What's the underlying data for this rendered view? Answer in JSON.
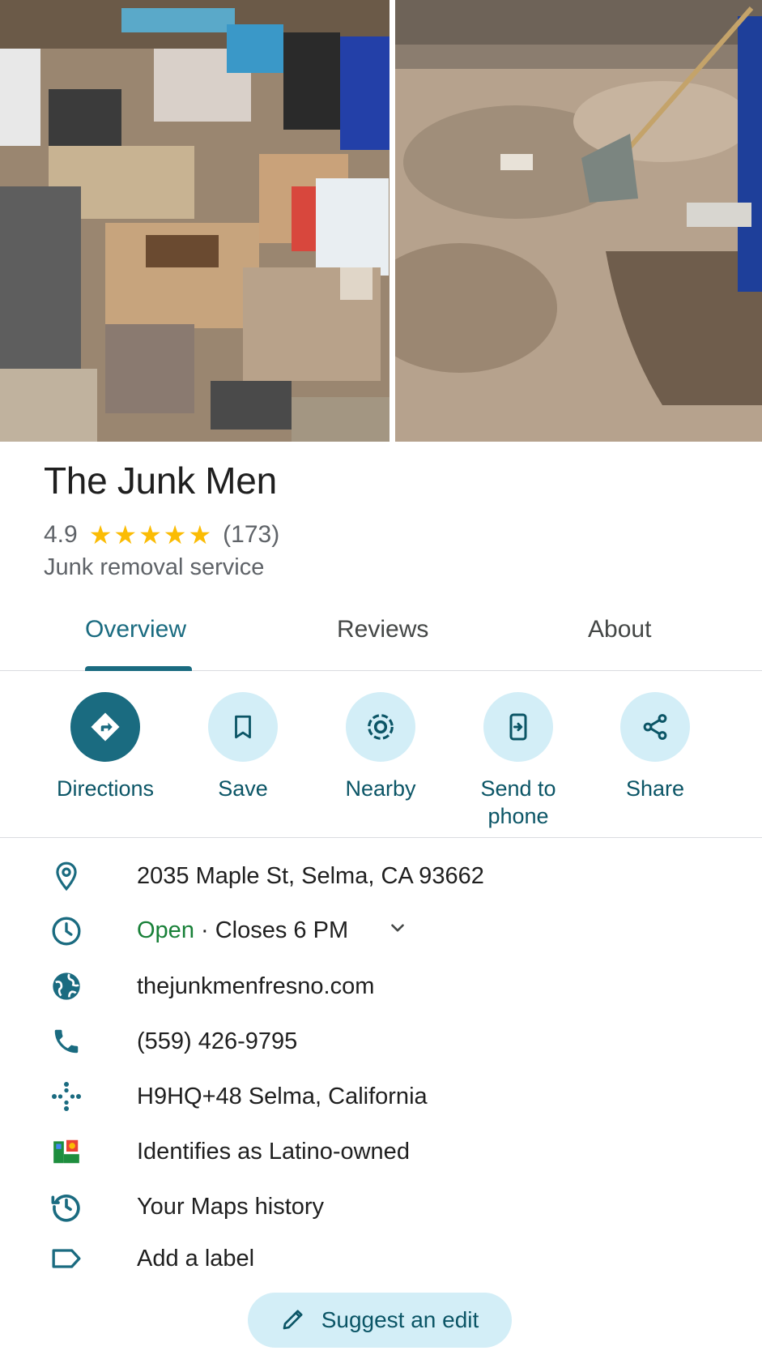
{
  "place": {
    "name": "The Junk Men",
    "rating": "4.9",
    "stars": 5,
    "review_count": "(173)",
    "category": "Junk removal service"
  },
  "tabs": [
    {
      "label": "Overview",
      "active": true
    },
    {
      "label": "Reviews",
      "active": false
    },
    {
      "label": "About",
      "active": false
    }
  ],
  "actions": [
    {
      "label": "Directions",
      "icon": "directions-icon"
    },
    {
      "label": "Save",
      "icon": "bookmark-icon"
    },
    {
      "label": "Nearby",
      "icon": "nearby-icon"
    },
    {
      "label": "Send to phone",
      "icon": "send-to-phone-icon"
    },
    {
      "label": "Share",
      "icon": "share-icon"
    }
  ],
  "info": {
    "address": "2035 Maple St, Selma, CA 93662",
    "hours_status": "Open",
    "hours_detail": " · Closes 6 PM",
    "website": "thejunkmenfresno.com",
    "phone": "(559) 426-9795",
    "plus_code": "H9HQ+48 Selma, California",
    "ownership": "Identifies as Latino-owned",
    "history": "Your Maps history",
    "label": "Add a label"
  },
  "suggest_edit": "Suggest an edit",
  "colors": {
    "accent": "#1a6b80",
    "chip_bg": "#d3eef7",
    "open_green": "#188038",
    "star": "#fbbc04"
  }
}
